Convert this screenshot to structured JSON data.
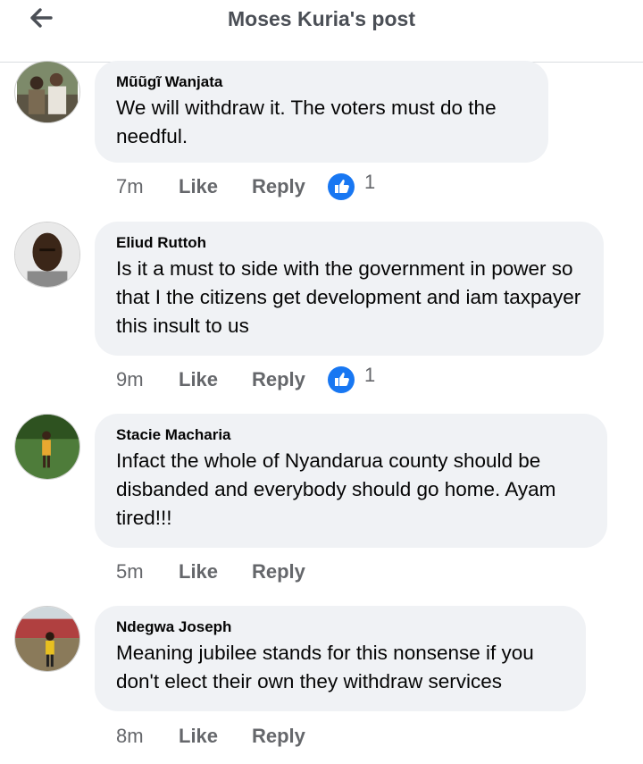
{
  "header": {
    "title": "Moses Kuria's post",
    "back_icon": "arrow-left-icon"
  },
  "colors": {
    "like_blue": "#1877f2",
    "bubble": "#f0f2f5",
    "meta": "#65676b"
  },
  "comments": [
    {
      "author": "Mũũgĩ Wanjata",
      "text": "We will withdraw it. The voters must do the needful.",
      "time": "7m",
      "like_label": "Like",
      "reply_label": "Reply",
      "reactions": "1"
    },
    {
      "author": "Eliud Ruttoh",
      "text": "Is it a must to side with the government in power so that I the citizens get development and iam taxpayer this insult to us",
      "time": "9m",
      "like_label": "Like",
      "reply_label": "Reply",
      "reactions": "1"
    },
    {
      "author": "Stacie Macharia",
      "text": "Infact the whole of Nyandarua county should be disbanded and everybody should go home. Ayam tired!!!",
      "time": "5m",
      "like_label": "Like",
      "reply_label": "Reply"
    },
    {
      "author": "Ndegwa Joseph",
      "text": "Meaning jubilee stands for this nonsense if you don't elect their own they withdraw services",
      "time": "8m",
      "like_label": "Like",
      "reply_label": "Reply"
    }
  ]
}
